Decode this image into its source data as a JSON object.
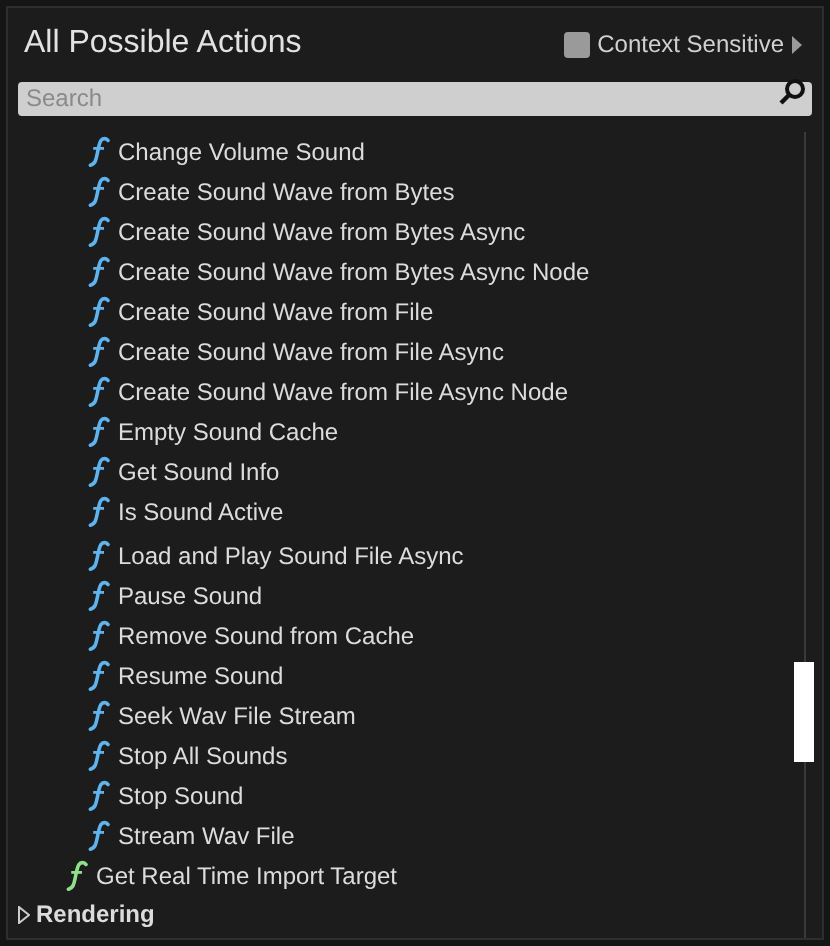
{
  "title": "All Possible Actions",
  "context_sensitive": {
    "label": "Context Sensitive",
    "checked": false
  },
  "search": {
    "placeholder": "Search"
  },
  "items": [
    {
      "label": "Change Volume Sound",
      "color": "#5fb4f0",
      "outer": false
    },
    {
      "label": "Create Sound Wave from Bytes",
      "color": "#5fb4f0",
      "outer": false
    },
    {
      "label": "Create Sound Wave from Bytes Async",
      "color": "#5fb4f0",
      "outer": false
    },
    {
      "label": "Create Sound Wave from Bytes Async Node",
      "color": "#5fb4f0",
      "outer": false
    },
    {
      "label": "Create Sound Wave from File",
      "color": "#5fb4f0",
      "outer": false
    },
    {
      "label": "Create Sound Wave from File Async",
      "color": "#5fb4f0",
      "outer": false
    },
    {
      "label": "Create Sound Wave from File Async Node",
      "color": "#5fb4f0",
      "outer": false
    },
    {
      "label": "Empty Sound Cache",
      "color": "#5fb4f0",
      "outer": false
    },
    {
      "label": "Get Sound Info",
      "color": "#5fb4f0",
      "outer": false
    },
    {
      "label": "Is Sound Active",
      "color": "#5fb4f0",
      "outer": false
    },
    {
      "label": "Load and Play Sound File Async",
      "color": "#5fb4f0",
      "outer": false
    },
    {
      "label": "Pause Sound",
      "color": "#5fb4f0",
      "outer": false
    },
    {
      "label": "Remove Sound from Cache",
      "color": "#5fb4f0",
      "outer": false
    },
    {
      "label": "Resume Sound",
      "color": "#5fb4f0",
      "outer": false
    },
    {
      "label": "Seek Wav File Stream",
      "color": "#5fb4f0",
      "outer": false
    },
    {
      "label": "Stop All Sounds",
      "color": "#5fb4f0",
      "outer": false
    },
    {
      "label": "Stop Sound",
      "color": "#5fb4f0",
      "outer": false
    },
    {
      "label": "Stream Wav File",
      "color": "#5fb4f0",
      "outer": false
    },
    {
      "label": "Get Real Time Import Target",
      "color": "#8fe08a",
      "outer": true
    }
  ],
  "categories": [
    {
      "label": "Rendering",
      "expanded": false
    }
  ]
}
